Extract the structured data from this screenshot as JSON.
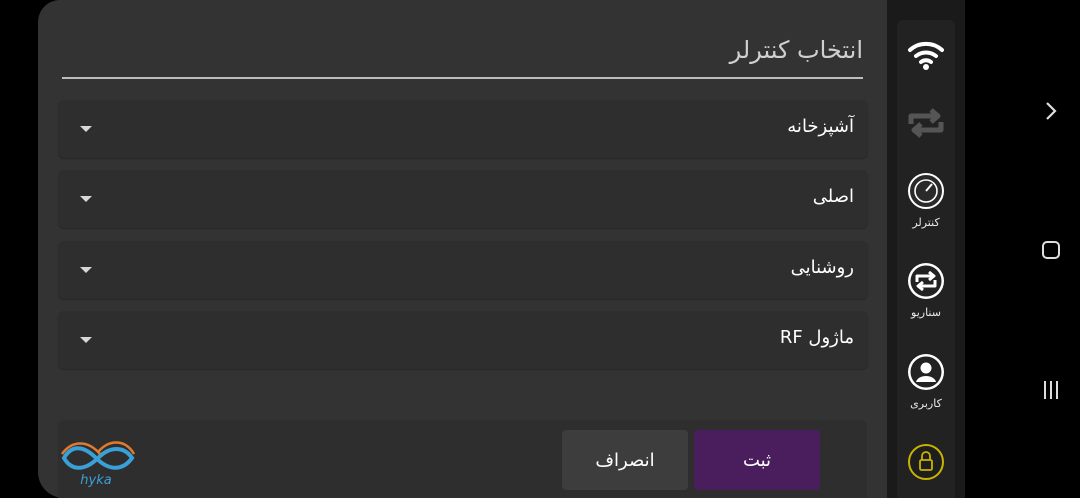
{
  "dialog": {
    "title": "انتخاب کنترلر",
    "dropdowns": [
      {
        "label": "آشپزخانه"
      },
      {
        "label": "اصلی"
      },
      {
        "label": "روشنایی"
      },
      {
        "label": "ماژول RF"
      }
    ],
    "submit_label": "ثبت",
    "cancel_label": "انصراف",
    "logo_text": "hyka"
  },
  "sidebar": {
    "items": [
      {
        "icon": "wifi-icon",
        "label": ""
      },
      {
        "icon": "sync-icon",
        "label": ""
      },
      {
        "icon": "gauge-icon",
        "label": "کنترلر"
      },
      {
        "icon": "scenario-icon",
        "label": "سناریو"
      },
      {
        "icon": "user-icon",
        "label": "کاربری"
      },
      {
        "icon": "lock-icon",
        "label": ""
      }
    ]
  },
  "navigation": {
    "icons": [
      "chevron-right-icon",
      "home-square-icon",
      "recent-apps-icon"
    ]
  },
  "colors": {
    "dialog_bg": "#333333",
    "field_bg": "#2e2e2e",
    "submit_bg": "#4a1e5c",
    "cancel_bg": "#3d3d3d",
    "logo_blue": "#3aa0d8",
    "lock_yellow": "#c8b400"
  }
}
